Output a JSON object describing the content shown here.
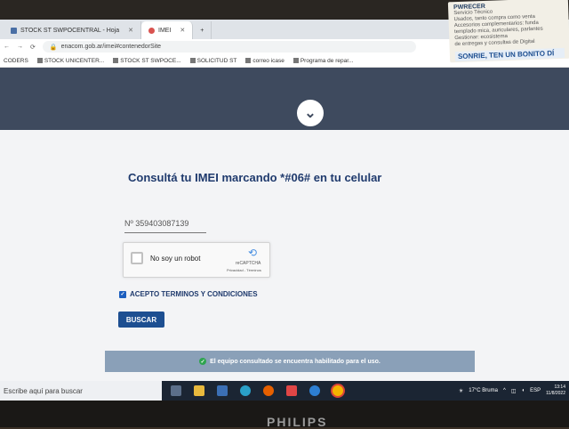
{
  "sticker": {
    "title": "PWRECER",
    "lines": [
      "Servicio Técnico",
      "Usados, tanto compra como venta",
      "Accesorios complementarios: funda",
      "templado mica, auriculares, parlantes"
    ],
    "manage": "Gestionar: ecosistema",
    "manage_sub": "de entregas y consultas de Digital",
    "footer": "SONRIE, TEN UN BONITO DÍ"
  },
  "tabs": [
    {
      "label": "STOCK ST SWPOCENTRAL - Hoja"
    },
    {
      "label": "IMEI"
    }
  ],
  "address": {
    "url": "enacom.gob.ar/imei#contenedorSite",
    "new_tab": "+"
  },
  "bookmarks": [
    "CODERS",
    "STOCK UNICENTER...",
    "STOCK ST SWPOCE...",
    "SOLICITUD ST",
    "correo icase",
    "Programa de repar..."
  ],
  "page": {
    "heading": "Consultá tu IMEI marcando *#06# en tu celular",
    "imei_value": "Nº 359403087139",
    "captcha_label": "No soy un robot",
    "captcha_brand": "reCAPTCHA",
    "captcha_links": "Privacidad - Términos",
    "terms_label": "ACEPTO TERMINOS Y CONDICIONES",
    "search_button": "BUSCAR",
    "alert_text": "El equipo consultado se encuentra habilitado para el uso."
  },
  "taskbar": {
    "search_placeholder": "Escribe aquí para buscar",
    "weather": "17°C  Bruma",
    "lang": "ESP",
    "time": "13:14",
    "date": "11/8/2022"
  },
  "monitor_brand": "PHILIPS",
  "colors": {
    "heading": "#1f3a6d",
    "button": "#1d4f91",
    "hero": "#3e4a5e",
    "alert": "#8aa0b8"
  }
}
